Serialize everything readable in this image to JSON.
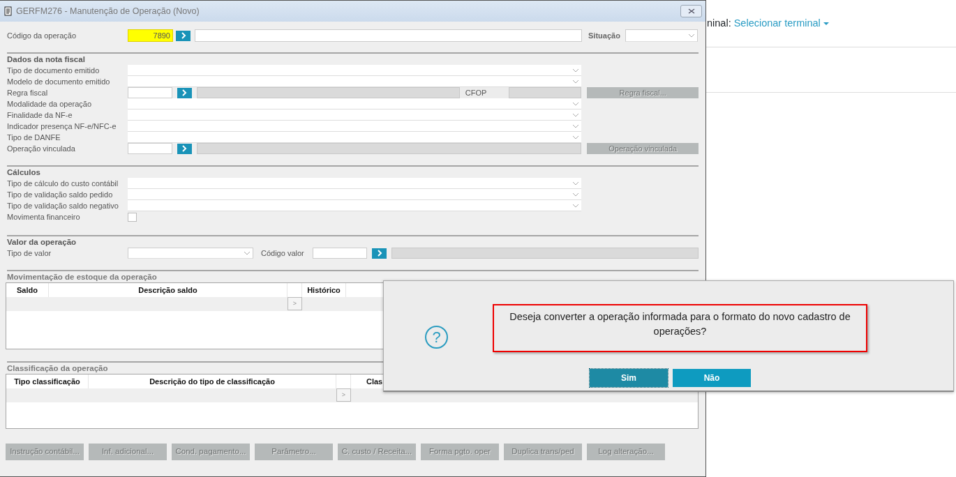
{
  "background": {
    "label": "ninal:",
    "terminal_link": "Selecionar terminal"
  },
  "window": {
    "title": "GERFM276 - Manutenção de Operação (Novo)"
  },
  "header": {
    "code_label": "Código da operação",
    "code_value": "7890",
    "status_label": "Situação"
  },
  "sections": [
    {
      "title": "Dados da nota fiscal",
      "fields": [
        {
          "label": "Tipo de documento emitido",
          "kind": "select"
        },
        {
          "label": "Modelo de documento emitido",
          "kind": "select"
        },
        {
          "label": "Regra fiscal",
          "kind": "lookup",
          "extra_label": "CFOP",
          "button": "Regra fiscal..."
        },
        {
          "label": "Modalidade da operação",
          "kind": "select"
        },
        {
          "label": "Finalidade da NF-e",
          "kind": "select"
        },
        {
          "label": "Indicador presença NF-e/NFC-e",
          "kind": "select"
        },
        {
          "label": "Tipo de DANFE",
          "kind": "select"
        },
        {
          "label": "Operação vinculada",
          "kind": "lookup",
          "button": "Operação vinculada"
        }
      ]
    },
    {
      "title": "Cálculos",
      "fields": [
        {
          "label": "Tipo de cálculo do custo contábil",
          "kind": "select"
        },
        {
          "label": "Tipo de validação saldo pedido",
          "kind": "select"
        },
        {
          "label": "Tipo de validação saldo negativo",
          "kind": "select"
        },
        {
          "label": "Movimenta financeiro",
          "kind": "checkbox",
          "checked": false
        }
      ]
    },
    {
      "title": "Valor da operação",
      "fields": [
        {
          "label": "Tipo de valor",
          "kind": "value",
          "lookup_label": "Código valor"
        }
      ]
    }
  ],
  "tables": [
    {
      "title": "Movimentação de estoque da operação",
      "columns": [
        "Saldo",
        "Descrição saldo",
        "Histórico"
      ],
      "row_button": ">"
    },
    {
      "title": "Classificação da operação",
      "columns": [
        "Tipo classificação",
        "Descrição do tipo de classificação",
        "Clas"
      ],
      "row_button": ">"
    }
  ],
  "buttons": [
    "Instrução contábil...",
    "Inf. adicional...",
    "Cond. pagamento...",
    "Parâmetro...",
    "C. custo / Receita...",
    "Forma pgto. oper",
    "Duplica trans/ped",
    "Log alteração..."
  ],
  "dialog": {
    "icon": "?",
    "message": "Deseja converter a operação informada para o formato do novo cadastro de operações?",
    "buttons": [
      {
        "label": "Sim",
        "selected": true
      },
      {
        "label": "Não",
        "selected": false
      }
    ]
  }
}
